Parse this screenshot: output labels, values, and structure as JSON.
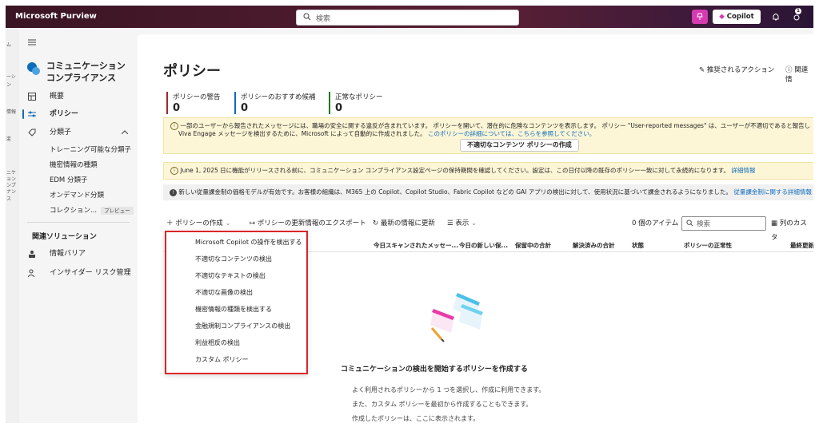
{
  "topbar": {
    "brand": "Microsoft Purview",
    "search_placeholder": "検索",
    "copilot_label": "Copilot",
    "notification_count": "1"
  },
  "rail": {
    "labels": [
      "ム",
      "ーシ",
      "ン",
      "情報",
      "変",
      "ニケ",
      "ョン",
      "ンプ",
      "ナンス"
    ]
  },
  "sidenav": {
    "solution_title": "コミュニケーション コンプライアンス",
    "items": [
      {
        "label": "概要",
        "icon": "overview-icon"
      },
      {
        "label": "ポリシー",
        "icon": "policy-icon",
        "active": true
      },
      {
        "label": "分類子",
        "icon": "classifier-icon"
      }
    ],
    "sub_items": [
      "トレーニング可能な分類子",
      "機密情報の種類",
      "EDM 分類子",
      "オンデマンド分類",
      "コレクション..."
    ],
    "preview_label": "プレビュー",
    "related_section": "関連ソリューション",
    "related_items": [
      {
        "label": "情報バリア",
        "icon": "barrier-icon"
      },
      {
        "label": "インサイダー リスク管理",
        "icon": "insider-icon"
      }
    ]
  },
  "main": {
    "title": "ポリシー",
    "actions": [
      {
        "label": "推奨されるアクション",
        "icon": "wand-icon"
      },
      {
        "label": "関連情",
        "icon": "info-icon"
      }
    ],
    "stats": [
      {
        "label": "ポリシーの警告",
        "value": "0",
        "color": "#a4262c"
      },
      {
        "label": "ポリシーのおすすめ候補",
        "value": "0",
        "color": "#0f6cbd"
      },
      {
        "label": "正常なポリシー",
        "value": "0",
        "color": "#107c10"
      }
    ],
    "warning": {
      "text1": "一部のユーザーから報告されたメッセージには、職場の安全に関する違反が含まれています。 ポリシーを開いて、潜在的に危険なコンテンツを表示します。 ポリシー \"User-reported messages\" は、ユーザーが不適切であると報告した Teams および",
      "text2": "Viva Engage メッセージを検出するために、Microsoft によって自動的に作成されました。",
      "link": "このポリシーの詳細については、こちらを参照してください。",
      "button": "不適切なコンテンツ ポリシーの作成"
    },
    "retention_notice": {
      "text": "June 1, 2025 日に機能がリリースされる前に、コミュニケーション コンプライアンス設定ページの保持期間を確認してください。設定は、この日付以降の既存のポリシー一致に対して永続的になります。",
      "link": "詳細情報"
    },
    "pricing_notice": {
      "text": "新しい従量課金制の価格モデルが有効です。お客様の組織は、M365 上の Copilot、Copilot Studio、Fabric Copilot などの GAI アプリの検出に対して、使用状況に基づいて課金されるようになりました。",
      "link": "従量課金制に関する詳細情報"
    },
    "toolbar": {
      "create": "ポリシーの作成",
      "export": "ポリシーの更新情報のエクスポート",
      "refresh": "最新の情報に更新",
      "view": "表示",
      "item_count": "0 個のアイテム",
      "search_placeholder": "検索",
      "columns": "列のカスタ"
    },
    "columns": [
      "今日スキャンされたメッセー...",
      "今日の新しい保...",
      "保留中の合計",
      "解決済みの合計",
      "状態",
      "ポリシーの正常性",
      "最終更新E"
    ],
    "dropdown": [
      "Microsoft Copilot の操作を検出する",
      "不適切なコンテンツの検出",
      "不適切なテキストの検出",
      "不適切な画像の検出",
      "機密情報の種類を検出する",
      "金融規制コンプライアンスの検出",
      "利益相反の検出",
      "カスタム ポリシー"
    ],
    "empty": {
      "title": "コミュニケーションの検出を開始するポリシーを作成する",
      "line1": "よく利用されるポリシーから 1 つを選択し、作成に利用できます。",
      "line2": "また、カスタム ポリシーを最初から作成することもできます。",
      "line3": "作成したポリシーは、ここに表示されます。"
    }
  }
}
